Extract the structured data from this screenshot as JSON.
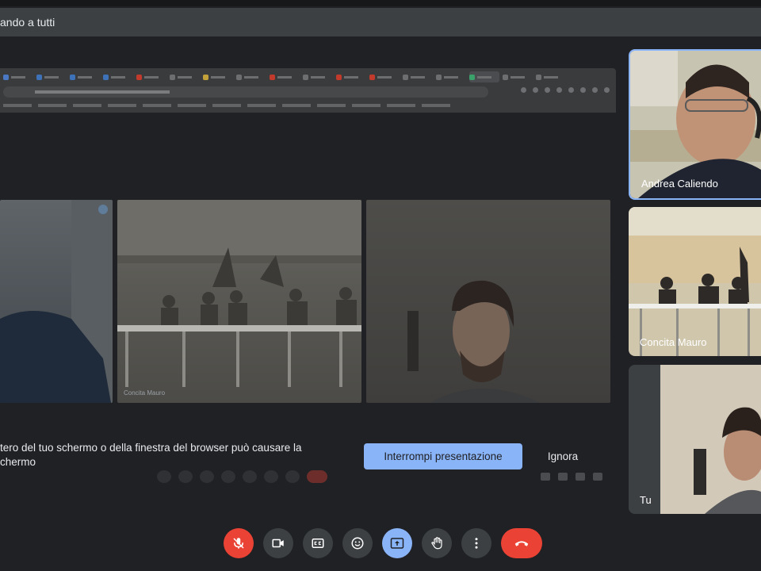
{
  "banner": {
    "text": "ando a tutti"
  },
  "presentation": {
    "tiles": [
      {
        "label": ""
      },
      {
        "label": "Concita Mauro"
      },
      {
        "label": ""
      }
    ],
    "notice_line1": "tero del tuo schermo o della finestra del browser può causare la",
    "notice_line2": "chermo",
    "stop_label": "Interrompi presentazione",
    "ignore_label": "Ignora"
  },
  "participants": [
    {
      "name": "Andrea Caliendo",
      "active_speaker": true
    },
    {
      "name": "Concita Mauro",
      "active_speaker": false
    },
    {
      "name": "Tu",
      "active_speaker": false
    }
  ],
  "controls": {
    "microphone": "muted",
    "accent_red": "#ea4335",
    "accent_blue": "#8ab4f8"
  }
}
